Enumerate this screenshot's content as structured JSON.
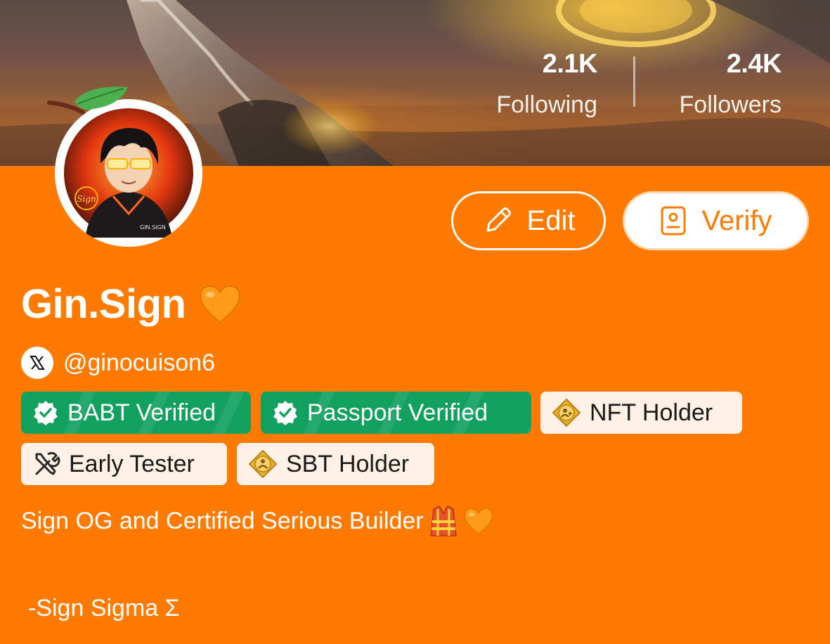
{
  "stats": {
    "following": {
      "count": "2.1K",
      "label": "Following"
    },
    "followers": {
      "count": "2.4K",
      "label": "Followers"
    }
  },
  "actions": {
    "edit_label": "Edit",
    "verify_label": "Verify"
  },
  "profile": {
    "display_name": "Gin.Sign",
    "name_emoji": "orange-heart-icon",
    "social": {
      "platform_icon": "x-logo-icon",
      "handle": "@ginocuison6"
    },
    "bio": "Sign OG and Certified Serious Builder",
    "bio_emojis": [
      "safety-vest-icon",
      "orange-heart-icon"
    ],
    "signature": "-Sign Sigma Σ"
  },
  "badges": [
    {
      "label": "BABT Verified",
      "icon": "verified-check-icon",
      "style": "green"
    },
    {
      "label": "Passport Verified",
      "icon": "verified-check-icon",
      "style": "green"
    },
    {
      "label": "NFT Holder",
      "icon": "gold-coin-icon",
      "style": "light"
    },
    {
      "label": "Early Tester",
      "icon": "tools-icon",
      "style": "light"
    },
    {
      "label": "SBT Holder",
      "icon": "gold-coin-icon",
      "style": "light"
    }
  ],
  "colors": {
    "brand_orange": "#ff7a00",
    "verified_green": "#11a05e",
    "badge_light_bg": "#fdf0e4",
    "white": "#ffffff"
  }
}
